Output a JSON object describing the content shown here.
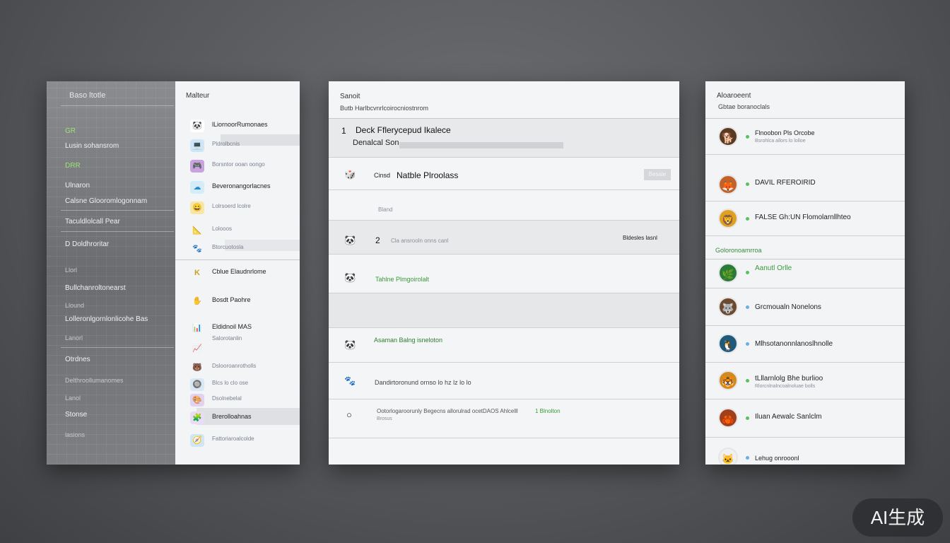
{
  "panel_a": {
    "dark": {
      "title": "Baso ltotle",
      "items": [
        "GR",
        "Lusin sohansrom",
        "DRR",
        "Ulnaron",
        "Calsne Glooromlogonnam",
        "Taculdlolcall Pear",
        "D Doldhroritar",
        "Llorl",
        "Bullchanroltonearst",
        "Llound",
        "Lolleronlgornlonlicohe Bas",
        "Lanorl",
        "Otrdnes",
        "Delthroollumanomes",
        "Lanol",
        "Stonse",
        "lasions"
      ]
    },
    "light": {
      "title": "Malteur",
      "rows": [
        {
          "icon": "🐼",
          "label": "lLiornoorRumonaes",
          "sub": false
        },
        {
          "icon": "💻",
          "label": "Pldrolbcnis",
          "sub": true
        },
        {
          "icon": "🎮",
          "label": "Borsntor ooan oongo",
          "sub": true
        },
        {
          "icon": "☁",
          "label": "Beveronangorlacnes",
          "sub": false
        },
        {
          "icon": "😄",
          "label": "Lolrsoerd lcolre",
          "sub": true
        },
        {
          "icon": "📐",
          "label": "Lolooos",
          "sub": true
        },
        {
          "icon": "🐾",
          "label": "Btorcuotosla",
          "sub": true
        },
        {
          "icon": "K",
          "label": "Cblue Elaudnrlome",
          "sub": false
        },
        {
          "icon": "✋",
          "label": "Bosdt Paohre",
          "sub": false
        },
        {
          "icon": "📊",
          "label": "Eldidnoil   MAS",
          "sub": false
        },
        {
          "icon": "📈",
          "label": "Salorotanlin",
          "sub": true
        },
        {
          "icon": "🐻",
          "label": "Dslooroanrotholls",
          "sub": true
        },
        {
          "icon": "🔘",
          "label": "Blcs   lo clo ose",
          "sub": true
        },
        {
          "icon": "🎨",
          "label": "Dsolnebelal",
          "sub": false
        },
        {
          "icon": "🧩",
          "label": "Brerolloahnas",
          "sub": true
        },
        {
          "icon": "🧭",
          "label": "Fattoriaroalcolde",
          "sub": true
        }
      ]
    }
  },
  "panel_b": {
    "title": "Sanoit",
    "subtitle": "Butb Harlbcvnrlcoirocniostnrom",
    "rows": [
      {
        "num": "1",
        "title": "Deck Fflerycepud  Ikalece",
        "line2": "Denalcal Son"
      },
      {
        "icon": "🎲",
        "prefix": "Cinsd",
        "title": "Natble Plroolass",
        "button": "Besale"
      },
      {
        "sub": "Bland"
      },
      {
        "icon": "🐼",
        "num": "2",
        "text": "Cla ansrooln onns canl",
        "right": "Bldesles lasnl"
      },
      {
        "icon": "🐼",
        "text": "Tahlne Plmgoirolalt",
        "green": true
      },
      {},
      {
        "icon": "🐼",
        "text": "Asaman Balng   isneloton",
        "green": true
      },
      {
        "icon": "🐾",
        "text": "Dandirtoronund ornso lo hz lz lo lo"
      },
      {
        "icon": "○",
        "text": "Ootorlogaroorunly Begecns allorulrad ocetDAOS Ahlcelll",
        "tail": "1  Blnolton",
        "sub": "Brosus"
      }
    ]
  },
  "panel_c": {
    "title": "Aloaroeent",
    "subtitle": "Gbtae boranoclals",
    "rows": [
      {
        "icon": "🐕",
        "name": "Flnoobon Pls  Orcobe",
        "sub": "Bsrohlca allors lo lolloe"
      },
      {
        "icon": "🦊",
        "name": "DAVIL RFEROIRID"
      },
      {
        "icon": "🦁",
        "name": "FALSE Gh:UN Flomolarnllhteo"
      },
      {
        "icon": "🌿",
        "name": "Aanutl Orlle",
        "green": true
      },
      {
        "icon": "🐺",
        "name": "Grcmoualn Nonelons"
      },
      {
        "icon": "🐧",
        "name": "Mlhsotanonnlanoslhnolle"
      },
      {
        "icon": "🐯",
        "name": "tLllarnlolg Bhe burlioo",
        "sub": "Rlorcnlnalncoalnoluae bolls"
      },
      {
        "icon": "🦀",
        "name": "Iluan Aewalc Sanlclm"
      },
      {
        "icon": "🐱",
        "name": "Lehug onrooonl"
      }
    ],
    "section": "Goloronoamrroa"
  },
  "badge": "AI生成",
  "colors": {
    "green": "#3a9a3a",
    "panel": "#f3f4f6",
    "background": "#55575a"
  }
}
